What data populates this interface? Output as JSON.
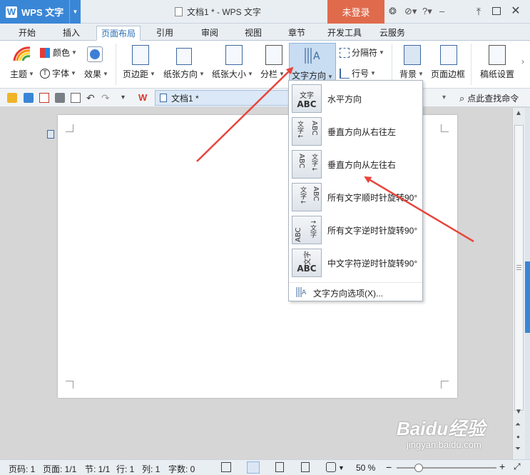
{
  "titlebar": {
    "app_name": "WPS 文字",
    "document_title": "文档1 * - WPS 文字",
    "login_button": "未登录"
  },
  "tabs": [
    {
      "label": "开始",
      "active": false
    },
    {
      "label": "插入",
      "active": false
    },
    {
      "label": "页面布局",
      "active": true
    },
    {
      "label": "引用",
      "active": false
    },
    {
      "label": "审阅",
      "active": false
    },
    {
      "label": "视图",
      "active": false
    },
    {
      "label": "章节",
      "active": false
    },
    {
      "label": "开发工具",
      "active": false
    },
    {
      "label": "云服务",
      "active": false
    }
  ],
  "ribbon": {
    "theme": "主题",
    "color": "颜色",
    "font": "字体",
    "effects": "效果",
    "margins": "页边距",
    "orientation": "纸张方向",
    "size": "纸张大小",
    "columns": "分栏",
    "text_direction": "文字方向",
    "breaks": "分隔符",
    "line_numbers": "行号",
    "background": "背景",
    "page_border": "页面边框",
    "paper_settings": "稿纸设置"
  },
  "quickbar": {
    "doc_tab": "文档1 *",
    "search_command": "点此查找命令"
  },
  "text_direction_menu": {
    "items": [
      {
        "label": "水平方向",
        "icon": "horizontal-text-icon"
      },
      {
        "label": "垂直方向从右往左",
        "icon": "vertical-rtl-icon"
      },
      {
        "label": "垂直方向从左往右",
        "icon": "vertical-ltr-icon"
      },
      {
        "label": "所有文字顺时针旋转90°",
        "icon": "rotate-cw-icon"
      },
      {
        "label": "所有文字逆时针旋转90°",
        "icon": "rotate-ccw-icon"
      },
      {
        "label": "中文字符逆时针旋转90°",
        "icon": "cjk-rotate-ccw-icon"
      }
    ],
    "options": "文字方向选项(X)..."
  },
  "statusbar": {
    "page": "页码: 1",
    "pages": "页面: 1/1",
    "section": "节: 1/1",
    "row": "行: 1",
    "col": "列: 1",
    "words": "字数: 0",
    "zoom": "50 %",
    "zoom_level_percent": 50
  },
  "watermark": {
    "brand": "Baidu经验",
    "url": "jingyan.baidu.com"
  },
  "colors": {
    "accent": "#3a86d6",
    "login": "#e06a4c",
    "arrow": "#e8453c"
  }
}
